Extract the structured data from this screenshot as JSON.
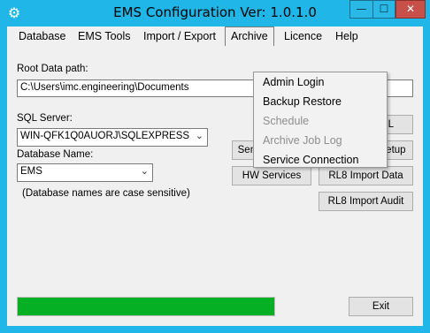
{
  "window": {
    "title": "EMS Configuration Ver: 1.0.1.0",
    "icon": "gear-icon",
    "minimize_glyph": "—",
    "maximize_glyph": "☐",
    "close_glyph": "✕"
  },
  "menu": {
    "items": [
      "Database",
      "EMS Tools",
      "Import / Export",
      "Archive",
      "Licence",
      "Help"
    ],
    "active": "Archive"
  },
  "archive_menu": {
    "items": [
      {
        "label": "Admin Login",
        "enabled": true
      },
      {
        "label": "Backup Restore",
        "enabled": true
      },
      {
        "label": "Schedule",
        "enabled": false
      },
      {
        "label": "Archive Job Log",
        "enabled": false
      },
      {
        "label": "Service Connection",
        "enabled": true
      }
    ]
  },
  "form": {
    "root_path_label": "Root Data path:",
    "root_path_value": "C:\\Users\\imc.engineering\\Documents",
    "sql_server_label": "SQL Server:",
    "sql_server_value": "WIN-QFK1Q0AUORJ\\SQLEXPRESS",
    "db_name_label": "Database Name:",
    "db_name_value": "EMS",
    "db_note": "(Database names are case sensitive)"
  },
  "buttons": {
    "partial_ml": "ML",
    "sensor_models": "Sensor Models",
    "hw_services": "HW Services",
    "rl8_import_setup": "RL8 Import Setup",
    "rl8_import_data": "RL8 Import Data",
    "rl8_import_audit": "RL8 Import Audit",
    "exit": "Exit"
  },
  "progress": {
    "fill_fraction": 1.0,
    "color": "#06b025"
  },
  "colors": {
    "titlebar": "#20b6e8",
    "close_button": "#c7504a"
  }
}
